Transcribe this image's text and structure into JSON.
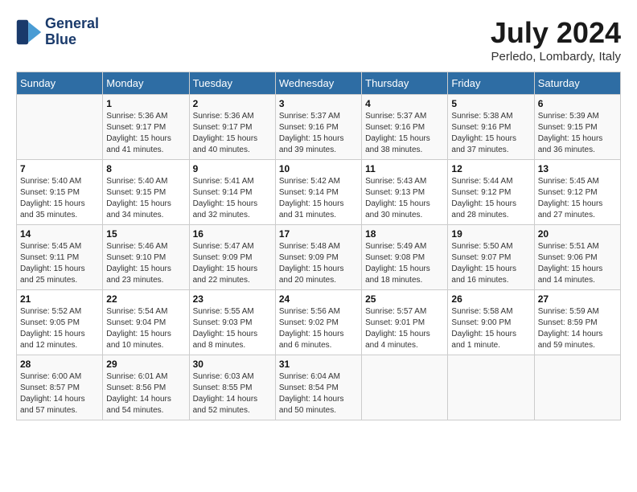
{
  "logo": {
    "line1": "General",
    "line2": "Blue"
  },
  "title": "July 2024",
  "location": "Perledo, Lombardy, Italy",
  "headers": [
    "Sunday",
    "Monday",
    "Tuesday",
    "Wednesday",
    "Thursday",
    "Friday",
    "Saturday"
  ],
  "weeks": [
    [
      {
        "day": "",
        "sunrise": "",
        "sunset": "",
        "daylight": ""
      },
      {
        "day": "1",
        "sunrise": "Sunrise: 5:36 AM",
        "sunset": "Sunset: 9:17 PM",
        "daylight": "Daylight: 15 hours and 41 minutes."
      },
      {
        "day": "2",
        "sunrise": "Sunrise: 5:36 AM",
        "sunset": "Sunset: 9:17 PM",
        "daylight": "Daylight: 15 hours and 40 minutes."
      },
      {
        "day": "3",
        "sunrise": "Sunrise: 5:37 AM",
        "sunset": "Sunset: 9:16 PM",
        "daylight": "Daylight: 15 hours and 39 minutes."
      },
      {
        "day": "4",
        "sunrise": "Sunrise: 5:37 AM",
        "sunset": "Sunset: 9:16 PM",
        "daylight": "Daylight: 15 hours and 38 minutes."
      },
      {
        "day": "5",
        "sunrise": "Sunrise: 5:38 AM",
        "sunset": "Sunset: 9:16 PM",
        "daylight": "Daylight: 15 hours and 37 minutes."
      },
      {
        "day": "6",
        "sunrise": "Sunrise: 5:39 AM",
        "sunset": "Sunset: 9:15 PM",
        "daylight": "Daylight: 15 hours and 36 minutes."
      }
    ],
    [
      {
        "day": "7",
        "sunrise": "Sunrise: 5:40 AM",
        "sunset": "Sunset: 9:15 PM",
        "daylight": "Daylight: 15 hours and 35 minutes."
      },
      {
        "day": "8",
        "sunrise": "Sunrise: 5:40 AM",
        "sunset": "Sunset: 9:15 PM",
        "daylight": "Daylight: 15 hours and 34 minutes."
      },
      {
        "day": "9",
        "sunrise": "Sunrise: 5:41 AM",
        "sunset": "Sunset: 9:14 PM",
        "daylight": "Daylight: 15 hours and 32 minutes."
      },
      {
        "day": "10",
        "sunrise": "Sunrise: 5:42 AM",
        "sunset": "Sunset: 9:14 PM",
        "daylight": "Daylight: 15 hours and 31 minutes."
      },
      {
        "day": "11",
        "sunrise": "Sunrise: 5:43 AM",
        "sunset": "Sunset: 9:13 PM",
        "daylight": "Daylight: 15 hours and 30 minutes."
      },
      {
        "day": "12",
        "sunrise": "Sunrise: 5:44 AM",
        "sunset": "Sunset: 9:12 PM",
        "daylight": "Daylight: 15 hours and 28 minutes."
      },
      {
        "day": "13",
        "sunrise": "Sunrise: 5:45 AM",
        "sunset": "Sunset: 9:12 PM",
        "daylight": "Daylight: 15 hours and 27 minutes."
      }
    ],
    [
      {
        "day": "14",
        "sunrise": "Sunrise: 5:45 AM",
        "sunset": "Sunset: 9:11 PM",
        "daylight": "Daylight: 15 hours and 25 minutes."
      },
      {
        "day": "15",
        "sunrise": "Sunrise: 5:46 AM",
        "sunset": "Sunset: 9:10 PM",
        "daylight": "Daylight: 15 hours and 23 minutes."
      },
      {
        "day": "16",
        "sunrise": "Sunrise: 5:47 AM",
        "sunset": "Sunset: 9:09 PM",
        "daylight": "Daylight: 15 hours and 22 minutes."
      },
      {
        "day": "17",
        "sunrise": "Sunrise: 5:48 AM",
        "sunset": "Sunset: 9:09 PM",
        "daylight": "Daylight: 15 hours and 20 minutes."
      },
      {
        "day": "18",
        "sunrise": "Sunrise: 5:49 AM",
        "sunset": "Sunset: 9:08 PM",
        "daylight": "Daylight: 15 hours and 18 minutes."
      },
      {
        "day": "19",
        "sunrise": "Sunrise: 5:50 AM",
        "sunset": "Sunset: 9:07 PM",
        "daylight": "Daylight: 15 hours and 16 minutes."
      },
      {
        "day": "20",
        "sunrise": "Sunrise: 5:51 AM",
        "sunset": "Sunset: 9:06 PM",
        "daylight": "Daylight: 15 hours and 14 minutes."
      }
    ],
    [
      {
        "day": "21",
        "sunrise": "Sunrise: 5:52 AM",
        "sunset": "Sunset: 9:05 PM",
        "daylight": "Daylight: 15 hours and 12 minutes."
      },
      {
        "day": "22",
        "sunrise": "Sunrise: 5:54 AM",
        "sunset": "Sunset: 9:04 PM",
        "daylight": "Daylight: 15 hours and 10 minutes."
      },
      {
        "day": "23",
        "sunrise": "Sunrise: 5:55 AM",
        "sunset": "Sunset: 9:03 PM",
        "daylight": "Daylight: 15 hours and 8 minutes."
      },
      {
        "day": "24",
        "sunrise": "Sunrise: 5:56 AM",
        "sunset": "Sunset: 9:02 PM",
        "daylight": "Daylight: 15 hours and 6 minutes."
      },
      {
        "day": "25",
        "sunrise": "Sunrise: 5:57 AM",
        "sunset": "Sunset: 9:01 PM",
        "daylight": "Daylight: 15 hours and 4 minutes."
      },
      {
        "day": "26",
        "sunrise": "Sunrise: 5:58 AM",
        "sunset": "Sunset: 9:00 PM",
        "daylight": "Daylight: 15 hours and 1 minute."
      },
      {
        "day": "27",
        "sunrise": "Sunrise: 5:59 AM",
        "sunset": "Sunset: 8:59 PM",
        "daylight": "Daylight: 14 hours and 59 minutes."
      }
    ],
    [
      {
        "day": "28",
        "sunrise": "Sunrise: 6:00 AM",
        "sunset": "Sunset: 8:57 PM",
        "daylight": "Daylight: 14 hours and 57 minutes."
      },
      {
        "day": "29",
        "sunrise": "Sunrise: 6:01 AM",
        "sunset": "Sunset: 8:56 PM",
        "daylight": "Daylight: 14 hours and 54 minutes."
      },
      {
        "day": "30",
        "sunrise": "Sunrise: 6:03 AM",
        "sunset": "Sunset: 8:55 PM",
        "daylight": "Daylight: 14 hours and 52 minutes."
      },
      {
        "day": "31",
        "sunrise": "Sunrise: 6:04 AM",
        "sunset": "Sunset: 8:54 PM",
        "daylight": "Daylight: 14 hours and 50 minutes."
      },
      {
        "day": "",
        "sunrise": "",
        "sunset": "",
        "daylight": ""
      },
      {
        "day": "",
        "sunrise": "",
        "sunset": "",
        "daylight": ""
      },
      {
        "day": "",
        "sunrise": "",
        "sunset": "",
        "daylight": ""
      }
    ]
  ]
}
